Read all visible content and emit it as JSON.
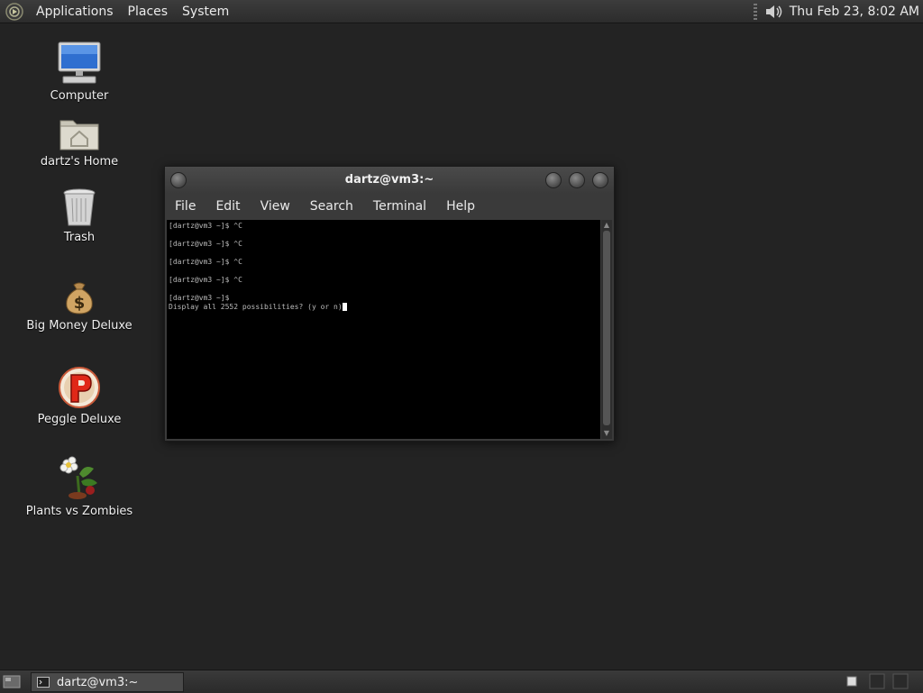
{
  "top_panel": {
    "menus": [
      "Applications",
      "Places",
      "System"
    ],
    "clock": "Thu Feb 23,  8:02 AM"
  },
  "desktop_icons": [
    {
      "label": "Computer",
      "icon": "computer-icon"
    },
    {
      "label": "dartz's Home",
      "icon": "home-folder-icon"
    },
    {
      "label": "Trash",
      "icon": "trash-icon"
    },
    {
      "label": "Big Money Deluxe",
      "icon": "money-bag-icon"
    },
    {
      "label": "Peggle Deluxe",
      "icon": "peggle-icon"
    },
    {
      "label": "Plants vs Zombies",
      "icon": "plants-vs-zombies-icon"
    }
  ],
  "terminal": {
    "title": "dartz@vm3:~",
    "menu": [
      "File",
      "Edit",
      "View",
      "Search",
      "Terminal",
      "Help"
    ],
    "lines": [
      "[dartz@vm3 ~]$ ^C",
      "",
      "[dartz@vm3 ~]$ ^C",
      "",
      "[dartz@vm3 ~]$ ^C",
      "",
      "[dartz@vm3 ~]$ ^C",
      "",
      "[dartz@vm3 ~]$",
      "Display all 2552 possibilities? (y or n)"
    ]
  },
  "taskbar": {
    "task_label": "dartz@vm3:~"
  }
}
